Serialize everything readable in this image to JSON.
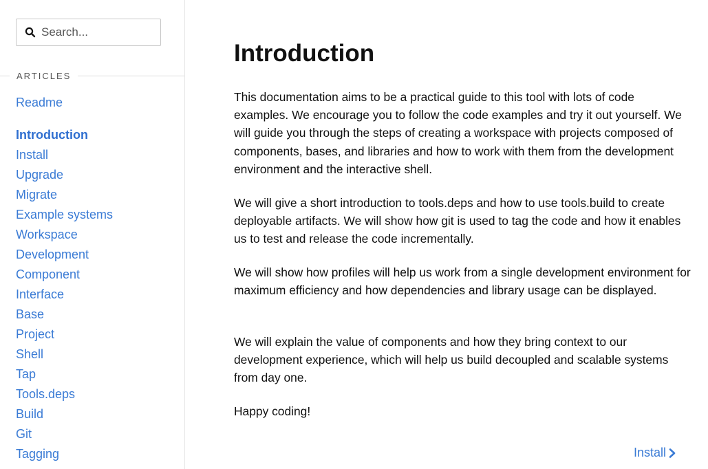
{
  "search": {
    "placeholder": "Search..."
  },
  "sidebar": {
    "section_title": "ARTICLES",
    "readme": "Readme",
    "items": [
      {
        "label": "Introduction",
        "active": true
      },
      {
        "label": "Install"
      },
      {
        "label": "Upgrade"
      },
      {
        "label": "Migrate"
      },
      {
        "label": "Example systems"
      },
      {
        "label": "Workspace"
      },
      {
        "label": "Development"
      },
      {
        "label": "Component"
      },
      {
        "label": "Interface"
      },
      {
        "label": "Base"
      },
      {
        "label": "Project"
      },
      {
        "label": "Shell"
      },
      {
        "label": "Tap"
      },
      {
        "label": "Tools.deps"
      },
      {
        "label": "Build"
      },
      {
        "label": "Git"
      },
      {
        "label": "Tagging"
      }
    ]
  },
  "main": {
    "title": "Introduction",
    "paragraphs": [
      "This documentation aims to be a practical guide to this tool with lots of code examples. We encourage you to follow the code examples and try it out yourself. We will guide you through the steps of creating a workspace with projects composed of components, bases, and libraries and how to work with them from the development environment and the interactive shell.",
      "We will give a short introduction to tools.deps and how to use tools.build to create deployable artifacts. We will show how git is used to tag the code and how it enables us to test and release the code incrementally.",
      "We will show how profiles will help us work from a single development environment for maximum efficiency and how dependencies and library usage can be displayed.",
      "We will explain the value of components and how they bring context to our development experience, which will help us build decoupled and scalable systems from day one.",
      "Happy coding!"
    ],
    "next_label": "Install"
  },
  "colors": {
    "link": "#3a7bd5",
    "text": "#111111",
    "border": "#e6e6e6"
  }
}
